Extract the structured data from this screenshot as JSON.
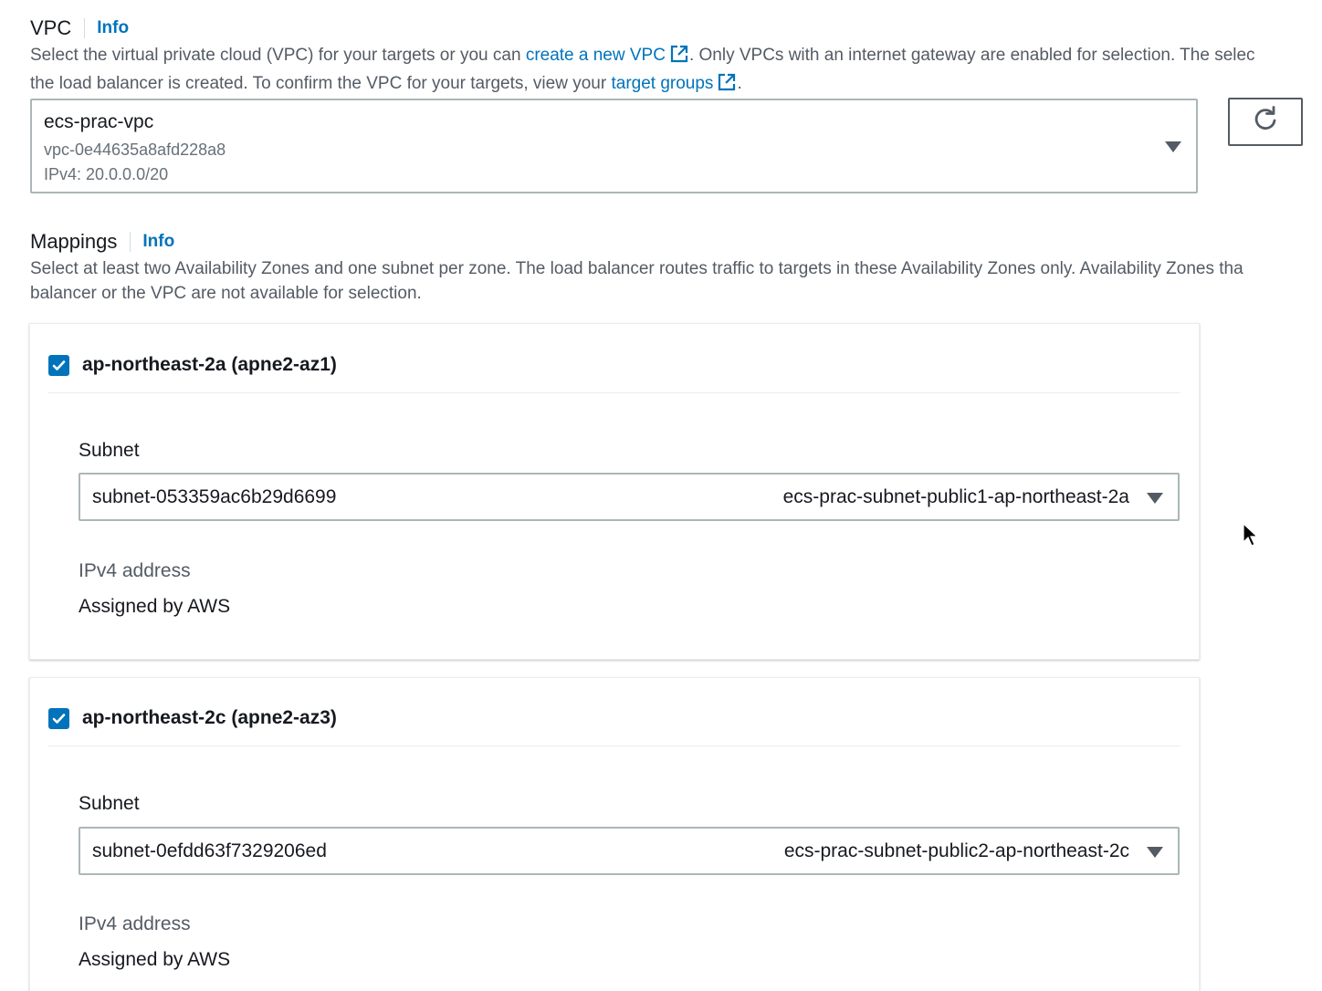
{
  "vpc": {
    "title": "VPC",
    "info": "Info",
    "desc_line1_a": "Select the virtual private cloud (VPC) for your targets or you can ",
    "desc_line1_link": "create a new VPC",
    "desc_line1_b": ". Only VPCs with an internet gateway are enabled for selection. The selec",
    "desc_line2_a": "the load balancer is created. To confirm the VPC for your targets, view your ",
    "desc_line2_link": "target groups",
    "desc_line2_b": ".",
    "selected_name": "ecs-prac-vpc",
    "selected_id": "vpc-0e44635a8afd228a8",
    "selected_cidr": "IPv4: 20.0.0.0/20",
    "refresh_icon": "refresh-icon"
  },
  "mappings": {
    "title": "Mappings",
    "info": "Info",
    "desc_line1": "Select at least two Availability Zones and one subnet per zone. The load balancer routes traffic to targets in these Availability Zones only. Availability Zones tha",
    "desc_line2": "balancer or the VPC are not available for selection.",
    "zones": [
      {
        "label": "ap-northeast-2a (apne2-az1)",
        "checked": true,
        "subnet_label": "Subnet",
        "subnet_id": "subnet-053359ac6b29d6699",
        "subnet_name": "ecs-prac-subnet-public1-ap-northeast-2a",
        "ipv4_label": "IPv4 address",
        "ipv4_value": "Assigned by AWS"
      },
      {
        "label": "ap-northeast-2c (apne2-az3)",
        "checked": true,
        "subnet_label": "Subnet",
        "subnet_id": "subnet-0efdd63f7329206ed",
        "subnet_name": "ecs-prac-subnet-public2-ap-northeast-2c",
        "ipv4_label": "IPv4 address",
        "ipv4_value": "Assigned by AWS"
      }
    ]
  },
  "colors": {
    "link": "#0073bb",
    "checkbox": "#0073bb",
    "border": "#aab7b8",
    "muted_text": "#545b64"
  }
}
